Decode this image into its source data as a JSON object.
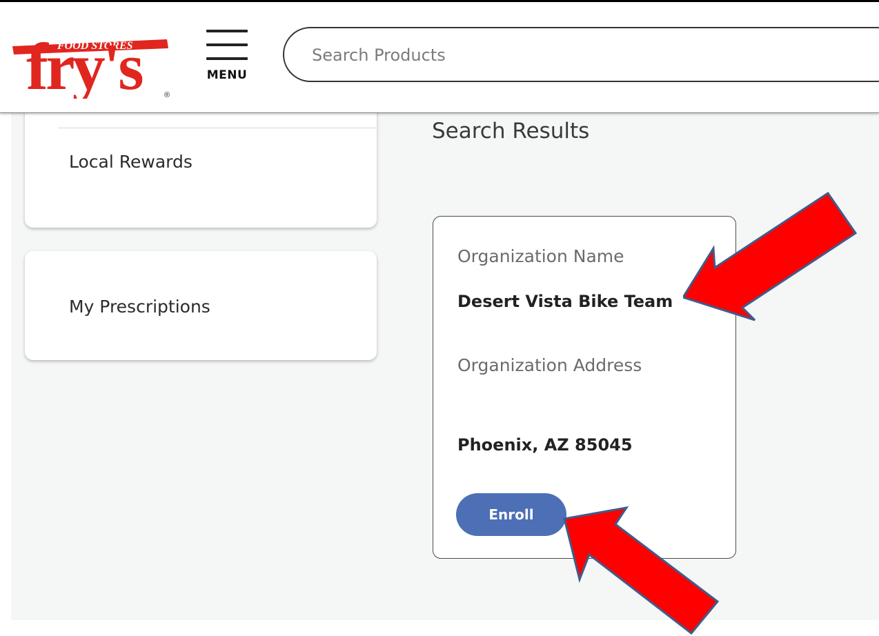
{
  "header": {
    "logo": {
      "tagline": "FOOD STORES",
      "wordmark": "fry's",
      "registered": "®"
    },
    "menu_label": "MENU",
    "search": {
      "placeholder": "Search Products",
      "value": ""
    }
  },
  "sidebar": {
    "items": [
      {
        "label": "Local Rewards"
      },
      {
        "label": "My Prescriptions"
      }
    ]
  },
  "results": {
    "title": "Search Results",
    "card": {
      "name_label": "Organization Name",
      "name": "Desert Vista Bike Team",
      "address_label": "Organization Address",
      "address_city": "Phoenix, AZ 85045",
      "enroll_label": "Enroll"
    }
  },
  "annotations": {
    "arrow_color": "#ff0000",
    "arrow_outline": "#3f5c8a"
  },
  "colors": {
    "brand_red": "#e0261f",
    "button_blue": "#4d6fb6"
  }
}
